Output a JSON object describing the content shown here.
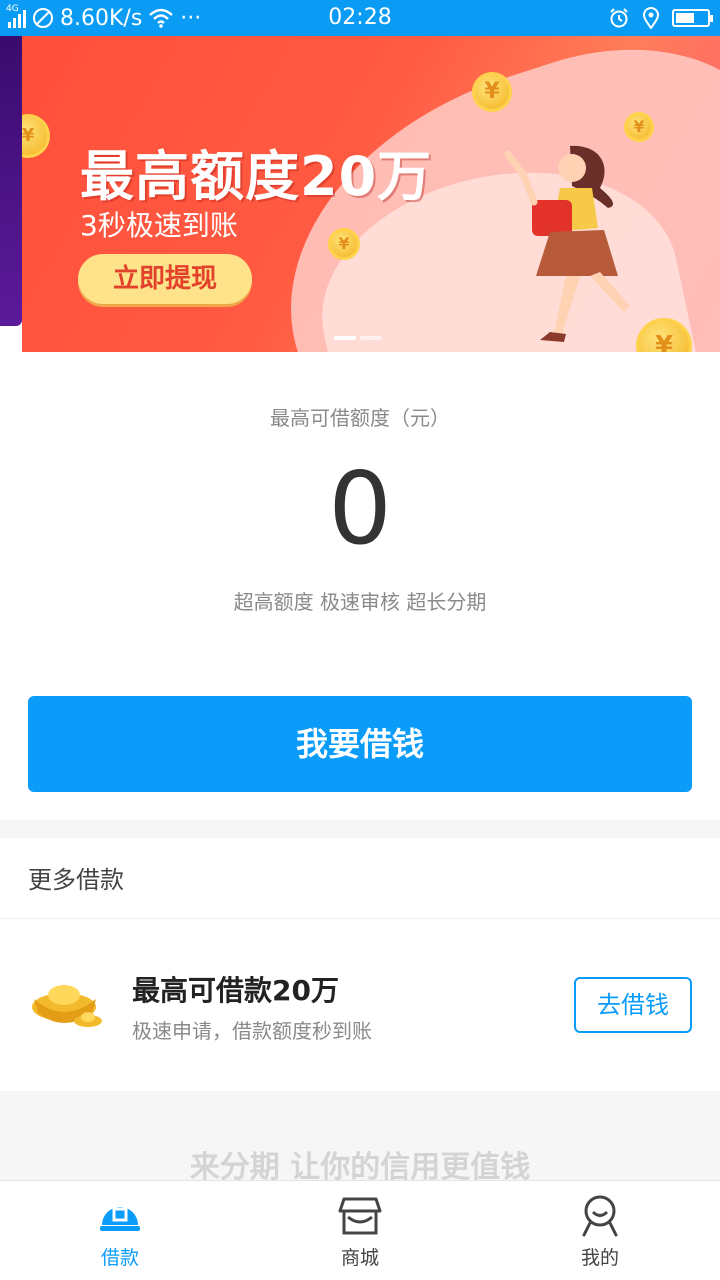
{
  "status_bar": {
    "network": "4G",
    "speed": "8.60K/s",
    "more": "···",
    "time": "02:28",
    "battery_level": 0.6
  },
  "banner": {
    "headline": "最高额度20万",
    "subline": "3秒极速到账",
    "cta": "立即提现",
    "coin_symbol": "¥",
    "page_count": 2,
    "active_page": 1
  },
  "credit": {
    "label": "最高可借额度（元）",
    "amount": "0",
    "description": "超高额度 极速审核 超长分期",
    "button": "我要借钱"
  },
  "more_loans": {
    "title": "更多借款",
    "items": [
      {
        "title": "最高可借款20万",
        "description": "极速申请，借款额度秒到账",
        "button": "去借钱"
      }
    ]
  },
  "slogan": "来分期 让你的信用更值钱",
  "tabs": [
    {
      "label": "借款",
      "icon": "loan-icon",
      "active": true
    },
    {
      "label": "商城",
      "icon": "store-icon",
      "active": false
    },
    {
      "label": "我的",
      "icon": "profile-icon",
      "active": false
    }
  ],
  "colors": {
    "primary": "#0b9bf8",
    "status_bar": "#0a9cf5",
    "banner_red": "#ff4f3b",
    "cta_yellow": "#ffe38a"
  }
}
